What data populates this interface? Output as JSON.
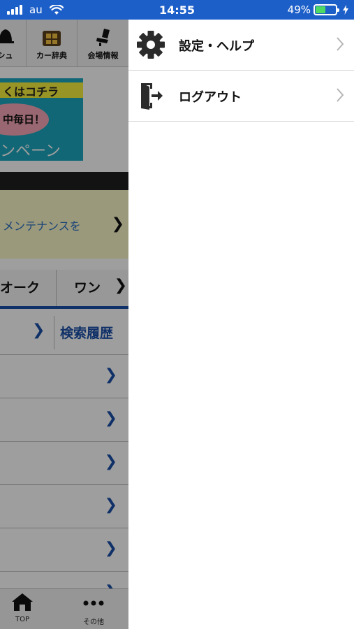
{
  "status_bar": {
    "carrier": "au",
    "time": "14:55",
    "battery_percent": "49%",
    "battery_level": 0.49,
    "charging_icon": "bolt-icon"
  },
  "background_app": {
    "nav": [
      {
        "label": "シュ",
        "icon": "bell-icon"
      },
      {
        "label": "カー辞典",
        "icon": "book-box-icon"
      },
      {
        "label": "会場情報",
        "icon": "seat-icon"
      }
    ],
    "banner": {
      "top": "くはコチラ",
      "middle": "中毎日！",
      "bottom": "ンペーン"
    },
    "notice_text": "メンテナンスを",
    "tabs": [
      "オーク",
      "ワン"
    ],
    "search_history": "検索履歴",
    "bottom_nav": [
      {
        "label": "TOP",
        "icon": "home-icon"
      },
      {
        "label": "その他",
        "icon": "more-icon"
      }
    ]
  },
  "drawer": {
    "items": [
      {
        "label": "設定・ヘルプ",
        "icon": "gear-icon"
      },
      {
        "label": "ログアウト",
        "icon": "logout-door-icon"
      }
    ]
  },
  "colors": {
    "status_bar": "#1d5fc9",
    "accent_blue": "#1b4fa8",
    "overlay": "rgba(0,0,0,0.38)"
  }
}
